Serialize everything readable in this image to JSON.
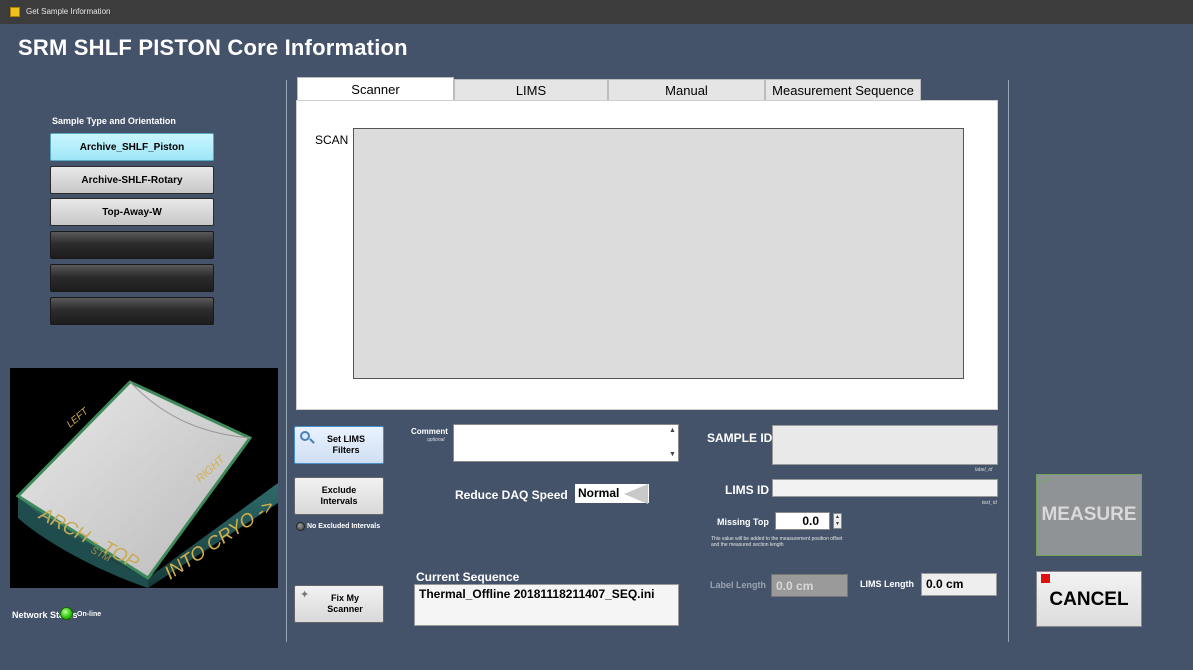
{
  "window": {
    "title": "Get Sample Information"
  },
  "header": {
    "title": "SRM SHLF PISTON Core Information"
  },
  "left_panel": {
    "sample_type_label": "Sample Type and Orientation",
    "buttons": [
      {
        "label": "Archive_SHLF_Piston",
        "state": "active"
      },
      {
        "label": "Archive-SHLF-Rotary",
        "state": "normal"
      },
      {
        "label": "Top-Away-W",
        "state": "normal"
      },
      {
        "label": "",
        "state": "empty"
      },
      {
        "label": "",
        "state": "empty"
      },
      {
        "label": "",
        "state": "empty"
      }
    ],
    "core_image_labels": {
      "left": "LEFT",
      "right": "RIGHT",
      "arch_top": "ARCH - TOP",
      "stm": "STM",
      "into_cryo": "INTO CRYO ->"
    },
    "network_status_label": "Network Status",
    "network_status_value": "On-line",
    "network_status_color": "#2fc90e"
  },
  "tabs": [
    {
      "label": "Scanner",
      "active": true
    },
    {
      "label": "LIMS",
      "active": false
    },
    {
      "label": "Manual",
      "active": false
    },
    {
      "label": "Measurement Sequence",
      "active": false
    }
  ],
  "scanner": {
    "scan_label": "SCAN"
  },
  "controls": {
    "set_lims_filters_label": "Set LIMS Filters",
    "exclude_intervals_label": "Exclude Intervals",
    "no_excluded_intervals": "No Excluded Intervals",
    "fix_scanner_label": "Fix My Scanner",
    "comment_label": "Comment",
    "comment_hint": "optional",
    "comment_value": "",
    "reduce_daq_label": "Reduce DAQ Speed",
    "reduce_daq_value": "Normal",
    "current_sequence_label": "Current Sequence",
    "current_sequence_value": "Thermal_Offline 20181118211407_SEQ.ini",
    "sample_id_label": "SAMPLE ID",
    "sample_id_value": "",
    "sample_id_caption": "label_id",
    "lims_id_label": "LIMS ID",
    "lims_id_value": "",
    "lims_id_caption": "text_id",
    "missing_top_label": "Missing Top",
    "missing_top_value": "0.0",
    "missing_top_note": "This value will be added to the measurement position offset and the measured section length",
    "label_length_label": "Label Length",
    "label_length_value": "0.0 cm",
    "lims_length_label": "LIMS Length",
    "lims_length_value": "0.0 cm"
  },
  "actions": {
    "measure_label": "MEASURE",
    "cancel_label": "CANCEL",
    "cancel_indicator_color": "#e01010"
  },
  "colors": {
    "background": "#44536a",
    "active_sample_button": "#9ee6f7",
    "measure_disabled": "#8f9395"
  }
}
